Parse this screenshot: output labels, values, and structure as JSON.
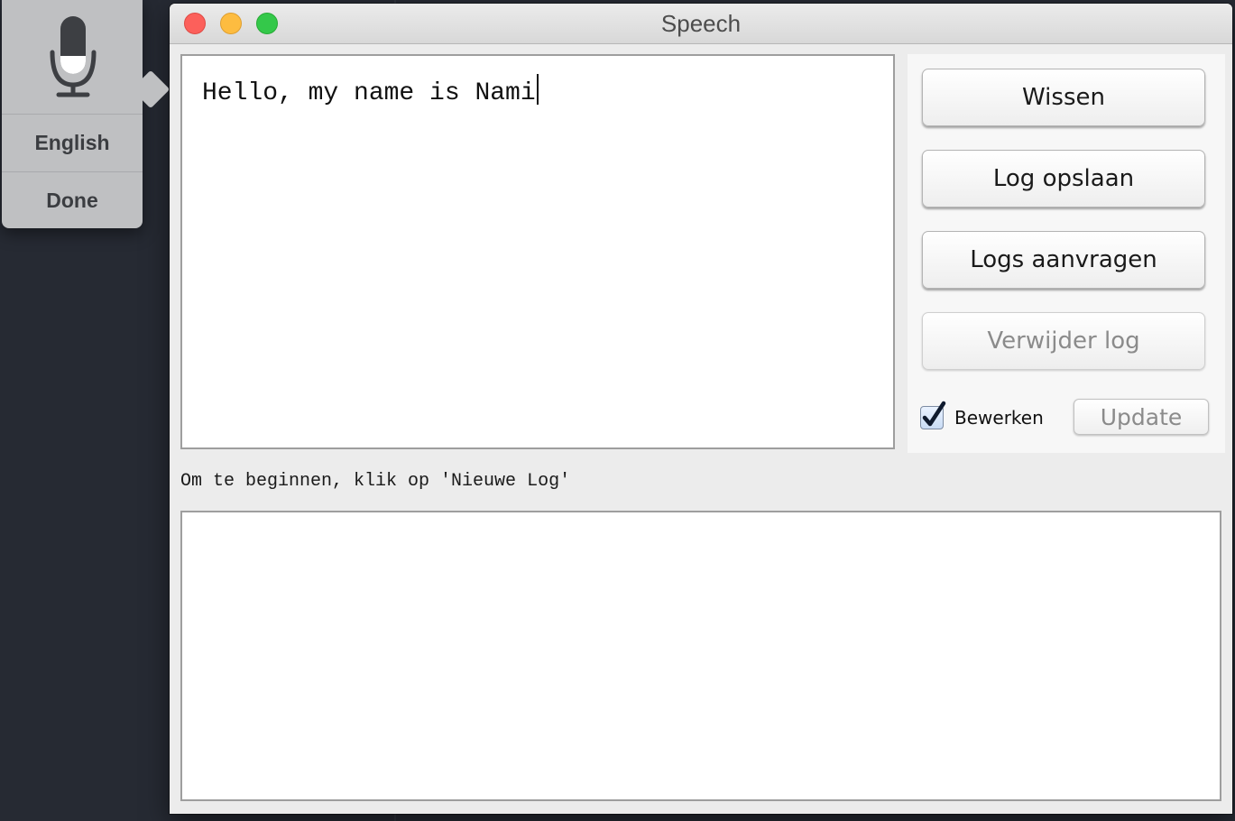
{
  "dictation": {
    "icon": "microphone-icon",
    "language_label": "English",
    "done_label": "Done"
  },
  "window": {
    "title": "Speech"
  },
  "editor": {
    "text": "Hello, my name is Nami"
  },
  "buttons": {
    "clear": "Wissen",
    "save_log": "Log opslaan",
    "request_logs": "Logs aanvragen",
    "delete_log": "Verwijder log",
    "update": "Update"
  },
  "edit_toggle": {
    "label": "Bewerken",
    "checked": true
  },
  "status_text": "Om te beginnen, klik op 'Nieuwe Log'",
  "log_text": "",
  "colors": {
    "close": "#fc605b",
    "minimize": "#fdbc40",
    "zoom": "#34c84a",
    "disabled_text": "#8b8b8b"
  }
}
